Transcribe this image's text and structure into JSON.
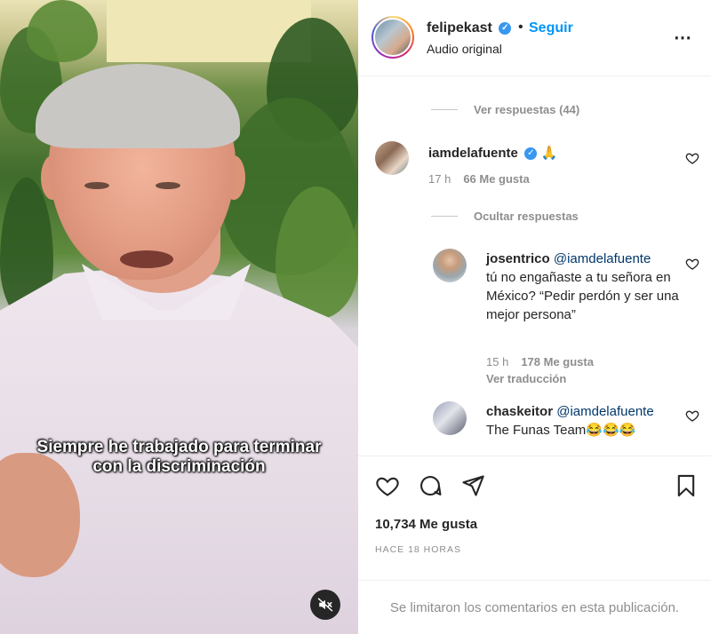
{
  "video": {
    "caption_line1": "Siempre he trabajado para terminar",
    "caption_line2": "con la discriminación",
    "mute_icon": "speaker-muted-icon"
  },
  "header": {
    "username": "felipekast",
    "follow_label": "Seguir",
    "audio_label": "Audio original",
    "separator": "•"
  },
  "comments": {
    "view_replies_label": "Ver respuestas (44)",
    "main_comment": {
      "username": "iamdelafuente",
      "text": "🙏",
      "time": "17 h",
      "likes": "66 Me gusta"
    },
    "hide_replies_label": "Ocultar respuestas",
    "replies": [
      {
        "username": "josentrico",
        "mention": "@iamdelafuente",
        "text": "tú no engañaste a tu señora en México? “Pedir perdón y ser una mejor persona”",
        "time": "15 h",
        "likes": "178 Me gusta",
        "translate": "Ver traducción"
      },
      {
        "username": "chaskeitor",
        "mention": "@iamdelafuente",
        "text": "The Funas Team😂😂😂"
      }
    ]
  },
  "actions": {
    "likes_count": "10,734 Me gusta",
    "posted_time": "HACE 18 HORAS"
  },
  "footer": {
    "limited_comments": "Se limitaron los comentarios en esta publicación."
  },
  "colors": {
    "accent": "#0095f6",
    "verified": "#3897f0",
    "muted_text": "#8e8e8e"
  }
}
